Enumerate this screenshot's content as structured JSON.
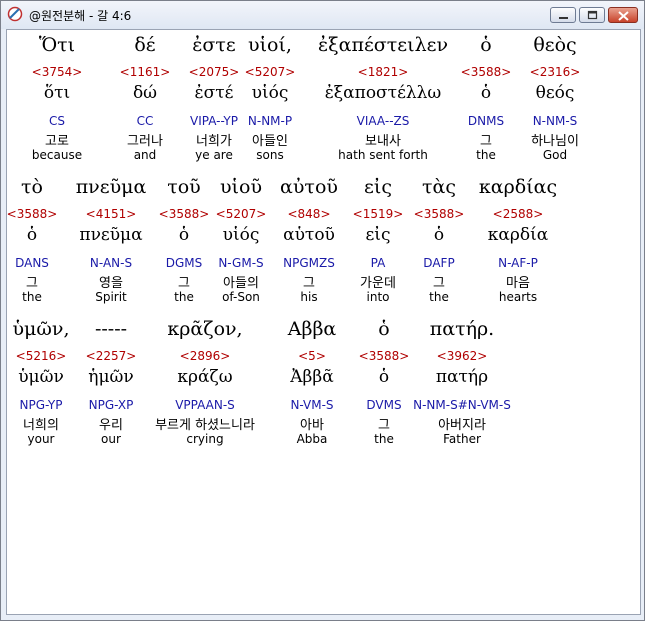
{
  "window": {
    "title": "@원전분해 - 갈 4:6"
  },
  "rows": [
    [
      {
        "g": "Ὅτι",
        "s": "<3754>",
        "l": "ὅτι",
        "p": "CS",
        "k": "고로",
        "e": "because"
      },
      {
        "g": "δέ",
        "s": "<1161>",
        "l": "δώ",
        "p": "CC",
        "k": "그러나",
        "e": "and"
      },
      {
        "g": "ἐστε",
        "s": "<2075>",
        "l": "ἐστέ",
        "p": "VIPA--YP",
        "k": "너희가",
        "e": "ye are"
      },
      {
        "g": "υἱοί,",
        "s": "<5207>",
        "l": "υἱός",
        "p": "N-NM-P",
        "k": "아들인",
        "e": "sons"
      },
      {
        "g": "ἐξαπέστειλεν",
        "s": "<1821>",
        "l": "ἐξαποστέλλω",
        "p": "VIAA--ZS",
        "k": "보내사",
        "e": "hath sent forth"
      },
      {
        "g": "ὁ",
        "s": "<3588>",
        "l": "ὁ",
        "p": "DNMS",
        "k": "그",
        "e": "the"
      },
      {
        "g": "θεὸς",
        "s": "<2316>",
        "l": "θεός",
        "p": "N-NM-S",
        "k": "하나님이",
        "e": "God"
      }
    ],
    [
      {
        "g": "τὸ",
        "s": "<3588>",
        "l": "ὁ",
        "p": "DANS",
        "k": "그",
        "e": "the"
      },
      {
        "g": "πνεῦμα",
        "s": "<4151>",
        "l": "πνεῦμα",
        "p": "N-AN-S",
        "k": "영을",
        "e": "Spirit"
      },
      {
        "g": "τοῦ",
        "s": "<3588>",
        "l": "ὁ",
        "p": "DGMS",
        "k": "그",
        "e": "the"
      },
      {
        "g": "υἱοῦ",
        "s": "<5207>",
        "l": "υἱός",
        "p": "N-GM-S",
        "k": "아들의",
        "e": "of-Son"
      },
      {
        "g": "αὐτοῦ",
        "s": "<848>",
        "l": "αὑτοῦ",
        "p": "NPGMZS",
        "k": "그",
        "e": "his"
      },
      {
        "g": "εἰς",
        "s": "<1519>",
        "l": "εἰς",
        "p": "PA",
        "k": "가운데",
        "e": "into"
      },
      {
        "g": "τὰς",
        "s": "<3588>",
        "l": "ὁ",
        "p": "DAFP",
        "k": "그",
        "e": "the"
      },
      {
        "g": "καρδίας",
        "s": "<2588>",
        "l": "καρδία",
        "p": "N-AF-P",
        "k": "마음",
        "e": "hearts"
      }
    ],
    [
      {
        "g": "ὑμῶν,",
        "s": "<5216>",
        "l": "ὑμῶν",
        "p": "NPG-YP",
        "k": "너희의",
        "e": "your"
      },
      {
        "g": "-----",
        "s": "<2257>",
        "l": "ἡμῶν",
        "p": "NPG-XP",
        "k": "우리",
        "e": "our"
      },
      {
        "g": "κρᾶζον,",
        "s": "<2896>",
        "l": "κράζω",
        "p": "VPPAAN-S",
        "k": "부르게 하셨느니라",
        "e": "crying"
      },
      {
        "g": "Αββα",
        "s": "<5>",
        "l": "Ἀββᾶ",
        "p": "N-VM-S",
        "k": "아바",
        "e": "Abba"
      },
      {
        "g": "ὁ",
        "s": "<3588>",
        "l": "ὁ",
        "p": "DVMS",
        "k": "그",
        "e": "the"
      },
      {
        "g": "πατήρ.",
        "s": "<3962>",
        "l": "πατήρ",
        "p": "N-NM-S#N-VM-S",
        "k": "아버지라",
        "e": "Father"
      }
    ]
  ]
}
